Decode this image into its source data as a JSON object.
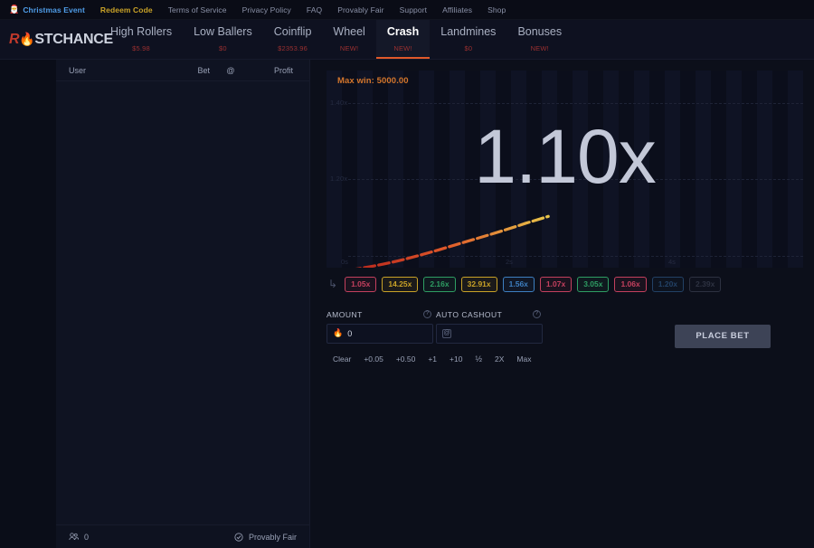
{
  "topbar": {
    "links": [
      {
        "label": "Christmas Event",
        "style": "xmas",
        "icon": "santa-icon"
      },
      {
        "label": "Redeem Code",
        "style": "redeem"
      },
      {
        "label": "Terms of Service",
        "style": "plain"
      },
      {
        "label": "Privacy Policy",
        "style": "plain"
      },
      {
        "label": "FAQ",
        "style": "plain"
      },
      {
        "label": "Provably Fair",
        "style": "plain"
      },
      {
        "label": "Support",
        "style": "plain"
      },
      {
        "label": "Affiliates",
        "style": "plain"
      },
      {
        "label": "Shop",
        "style": "plain"
      }
    ]
  },
  "brand": {
    "part1": "R",
    "flame": "●",
    "part2": "ST",
    "part3": "CHANCE",
    "full": "RUSTCHANCE"
  },
  "nav": {
    "items": [
      {
        "label": "High Rollers",
        "sub": "$5.98",
        "active": false
      },
      {
        "label": "Low Ballers",
        "sub": "$0",
        "active": false
      },
      {
        "label": "Coinflip",
        "sub": "$2353.96",
        "active": false
      },
      {
        "label": "Wheel",
        "sub": "NEW!",
        "active": false
      },
      {
        "label": "Crash",
        "sub": "NEW!",
        "active": true
      },
      {
        "label": "Landmines",
        "sub": "$0",
        "active": false
      },
      {
        "label": "Bonuses",
        "sub": "NEW!",
        "active": false
      }
    ]
  },
  "sidebar": {
    "columns": {
      "user": "User",
      "bet": "Bet",
      "at": "@",
      "profit": "Profit"
    },
    "rows": [],
    "footer": {
      "player_count": "0",
      "provably_fair": "Provably Fair"
    }
  },
  "game": {
    "max_win_label": "Max win: 5000.00",
    "current_multiplier": "1.10x",
    "history_arrow": "↳",
    "history": [
      {
        "value": "1.05x",
        "color": "#c4405e",
        "faded": false
      },
      {
        "value": "14.25x",
        "color": "#c9a227",
        "faded": false
      },
      {
        "value": "2.16x",
        "color": "#2e9e63",
        "faded": false
      },
      {
        "value": "32.91x",
        "color": "#c9a227",
        "faded": false
      },
      {
        "value": "1.56x",
        "color": "#3d7fc1",
        "faded": false
      },
      {
        "value": "1.07x",
        "color": "#c4405e",
        "faded": false
      },
      {
        "value": "3.05x",
        "color": "#2e9e63",
        "faded": false
      },
      {
        "value": "1.06x",
        "color": "#c4405e",
        "faded": false
      },
      {
        "value": "1.20x",
        "color": "#3d7fc1",
        "faded": true
      },
      {
        "value": "2.39x",
        "color": "#555c72",
        "faded": true
      }
    ]
  },
  "chart_data": {
    "type": "line",
    "title": "Max win: 5000.00",
    "xlabel": "",
    "ylabel": "",
    "x": [
      0,
      0.25,
      0.5,
      0.75,
      1.0,
      1.25,
      1.5,
      1.75,
      2.0,
      2.25,
      2.5,
      2.75,
      3.0
    ],
    "values": [
      1.0,
      1.012,
      1.025,
      1.036,
      1.046,
      1.054,
      1.062,
      1.07,
      1.077,
      1.084,
      1.09,
      1.095,
      1.1
    ],
    "xticks": [
      "0s",
      "2s",
      "4s"
    ],
    "yticks": [
      "1.40x",
      "1.20x"
    ],
    "ylim": [
      1.0,
      1.5
    ],
    "grid": true,
    "legend": false,
    "series_color": "#e0592a"
  },
  "bet": {
    "amount": {
      "label": "AMOUNT",
      "value": "0",
      "icon": "flame-icon",
      "help": "?"
    },
    "auto_cashout": {
      "label": "AUTO CASHOUT",
      "value": "",
      "placeholder": "",
      "icon": "at-icon",
      "help": "?"
    },
    "quick_buttons": [
      "Clear",
      "+0.05",
      "+0.50",
      "+1",
      "+10",
      "½",
      "2X",
      "Max"
    ],
    "place_bet_label": "PLACE BET"
  }
}
